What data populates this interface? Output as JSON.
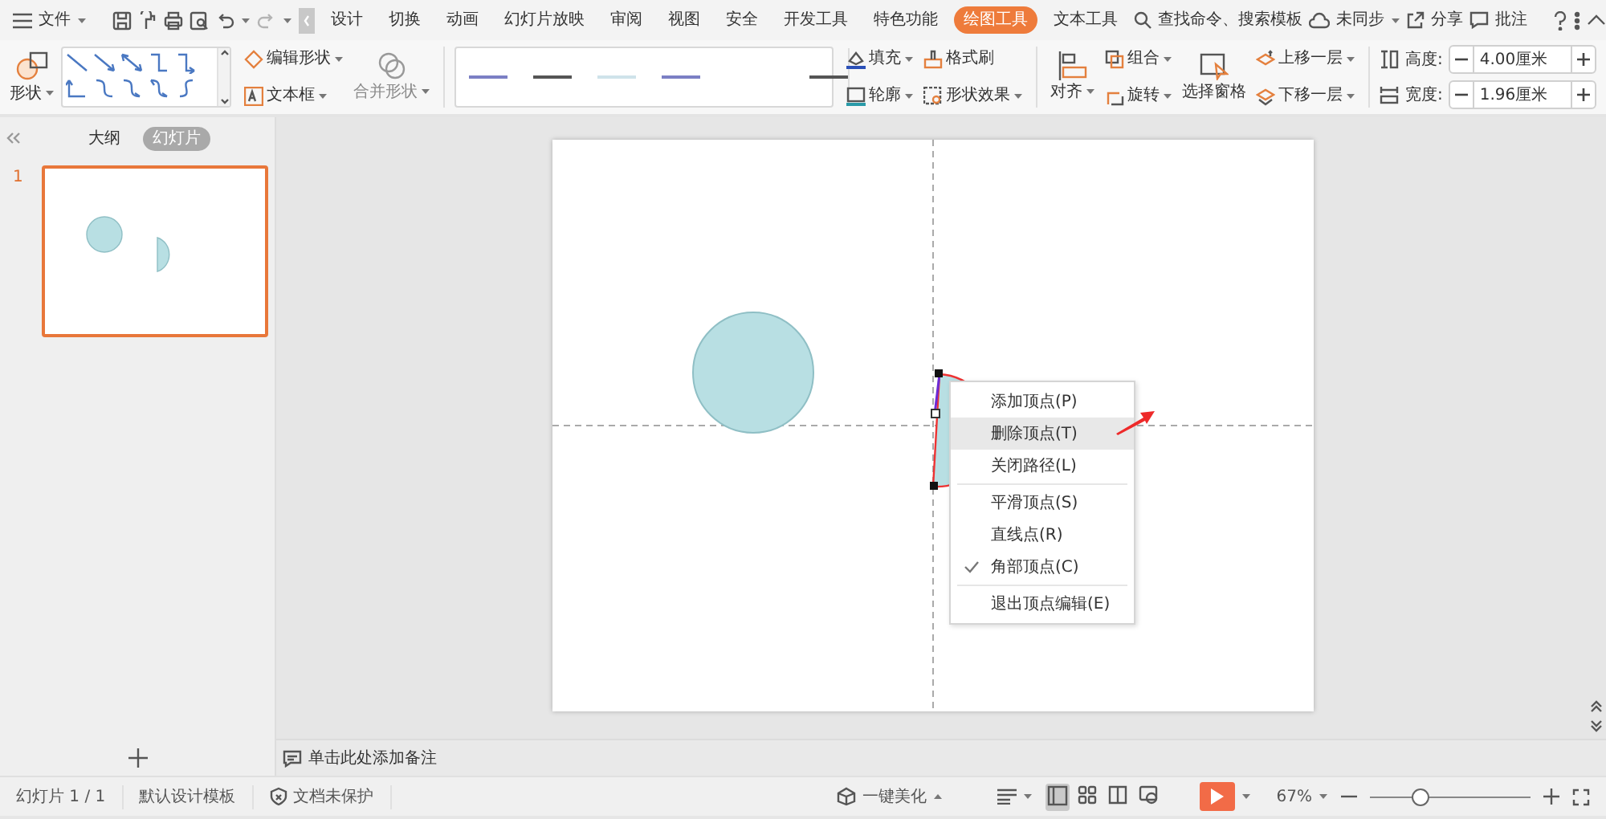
{
  "menu_bar": {
    "file": "文件",
    "tabs": [
      {
        "label": "设计",
        "selected": false
      },
      {
        "label": "切换",
        "selected": false
      },
      {
        "label": "动画",
        "selected": false
      },
      {
        "label": "幻灯片放映",
        "selected": false
      },
      {
        "label": "审阅",
        "selected": false
      },
      {
        "label": "视图",
        "selected": false
      },
      {
        "label": "安全",
        "selected": false
      },
      {
        "label": "开发工具",
        "selected": false
      },
      {
        "label": "特色功能",
        "selected": false
      },
      {
        "label": "绘图工具",
        "selected": true
      },
      {
        "label": "文本工具",
        "selected": false
      }
    ],
    "search": "查找命令、搜索模板",
    "sync": "未同步",
    "share": "分享",
    "comment": "批注"
  },
  "ribbon": {
    "shape": "形状",
    "edit_shape": "编辑形状",
    "text_box": "文本框",
    "merge_shape": {
      "label": "合并形状",
      "disabled": true
    },
    "line_styles": [
      {
        "color": "#7b7fc4"
      },
      {
        "color": "#555555"
      },
      {
        "color": "#cfe3ea"
      },
      {
        "color": "#7b7fc4"
      },
      {
        "color": "#555555"
      }
    ],
    "fill": "填充",
    "format_painter": "格式刷",
    "outline": "轮廓",
    "shape_effects": "形状效果",
    "align": "对齐",
    "group": "组合",
    "rotate": "旋转",
    "selection_pane": "选择窗格",
    "bring_forward": "上移一层",
    "send_backward": "下移一层",
    "height": {
      "label": "高度:",
      "value": "4.00厘米"
    },
    "width": {
      "label": "宽度:",
      "value": "1.96厘米"
    }
  },
  "left_panel": {
    "tabs": [
      {
        "label": "大纲",
        "selected": false
      },
      {
        "label": "幻灯片",
        "selected": true
      }
    ],
    "slides": [
      {
        "number": "1",
        "selected": true
      }
    ]
  },
  "context_menu": {
    "sections": [
      {
        "items": [
          {
            "label": "添加顶点(P)",
            "selected": false,
            "checked": false
          },
          {
            "label": "删除顶点(T)",
            "selected": true,
            "checked": false
          },
          {
            "label": "关闭路径(L)",
            "selected": false,
            "checked": false
          }
        ]
      },
      {
        "items": [
          {
            "label": "平滑顶点(S)",
            "selected": false,
            "checked": false
          },
          {
            "label": "直线点(R)",
            "selected": false,
            "checked": false
          },
          {
            "label": "角部顶点(C)",
            "selected": false,
            "checked": true
          }
        ]
      },
      {
        "items": [
          {
            "label": "退出顶点编辑(E)",
            "selected": false,
            "checked": false
          }
        ]
      }
    ]
  },
  "notes": {
    "placeholder": "单击此处添加备注"
  },
  "status_bar": {
    "slide_count": "幻灯片 1 / 1",
    "template": "默认设计模板",
    "protection": "文档未保护",
    "beautify": "一键美化",
    "views": [
      {
        "kind": "normal",
        "selected": true
      },
      {
        "kind": "sorter",
        "selected": false
      },
      {
        "kind": "reading",
        "selected": false
      },
      {
        "kind": "presenter",
        "selected": false
      }
    ],
    "zoom": "67%",
    "zoom_slider": {
      "level": 0.31
    }
  }
}
